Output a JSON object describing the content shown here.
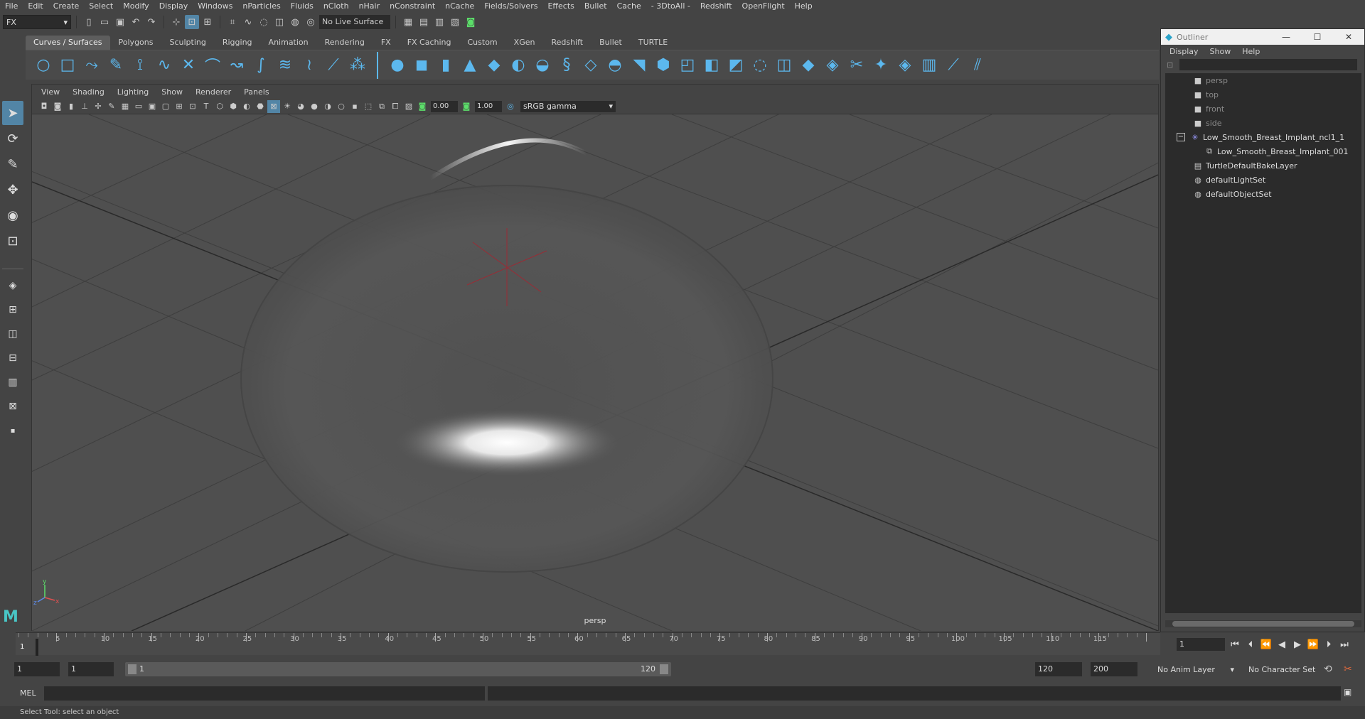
{
  "menubar": {
    "items": [
      "File",
      "Edit",
      "Create",
      "Select",
      "Modify",
      "Display",
      "Windows",
      "nParticles",
      "Fluids",
      "nCloth",
      "nHair",
      "nConstraint",
      "nCache",
      "Fields/Solvers",
      "Effects",
      "Bullet",
      "Cache",
      "- 3DtoAll -",
      "Redshift",
      "OpenFlight",
      "Help"
    ]
  },
  "statusline": {
    "mode": "FX",
    "live_surface": "No Live Surface"
  },
  "shelf": {
    "tabs": [
      "Curves / Surfaces",
      "Polygons",
      "Sculpting",
      "Rigging",
      "Animation",
      "Rendering",
      "FX",
      "FX Caching",
      "Custom",
      "XGen",
      "Redshift",
      "Bullet",
      "TURTLE"
    ],
    "active_tab": "Curves / Surfaces"
  },
  "viewport": {
    "menu": [
      "View",
      "Shading",
      "Lighting",
      "Show",
      "Renderer",
      "Panels"
    ],
    "exposure": "0.00",
    "gamma": "1.00",
    "color_space": "sRGB gamma",
    "camera_label": "persp"
  },
  "outliner": {
    "title": "Outliner",
    "menu": [
      "Display",
      "Show",
      "Help"
    ],
    "items": [
      {
        "label": "persp",
        "icon": "camera-icon"
      },
      {
        "label": "top",
        "icon": "camera-icon"
      },
      {
        "label": "front",
        "icon": "camera-icon"
      },
      {
        "label": "side",
        "icon": "camera-icon"
      },
      {
        "label": "Low_Smooth_Breast_Implant_ncl1_1",
        "icon": "ncloth-icon"
      },
      {
        "label": "Low_Smooth_Breast_Implant_001",
        "icon": "mesh-icon"
      },
      {
        "label": "TurtleDefaultBakeLayer",
        "icon": "bake-layer-icon"
      },
      {
        "label": "defaultLightSet",
        "icon": "set-icon"
      },
      {
        "label": "defaultObjectSet",
        "icon": "set-icon"
      }
    ]
  },
  "timeline": {
    "ticks": [
      "5",
      "10",
      "15",
      "20",
      "25",
      "30",
      "35",
      "40",
      "45",
      "50",
      "55",
      "60",
      "65",
      "70",
      "75",
      "80",
      "85",
      "90",
      "95",
      "100",
      "105",
      "110",
      "115"
    ],
    "current_frame": "1",
    "frame_field": "1"
  },
  "range": {
    "start": "1",
    "playback_start": "1",
    "slider_start": "1",
    "slider_end": "120",
    "playback_end": "120",
    "end": "200",
    "anim_layer": "No Anim Layer",
    "character_set": "No Character Set"
  },
  "commandline": {
    "label": "MEL"
  },
  "helpline": {
    "text": "Select Tool: select an object"
  },
  "colors": {
    "accent": "#5285a6",
    "shelf_icon": "#5cb8ee",
    "key_icon": "#e06a3e"
  }
}
